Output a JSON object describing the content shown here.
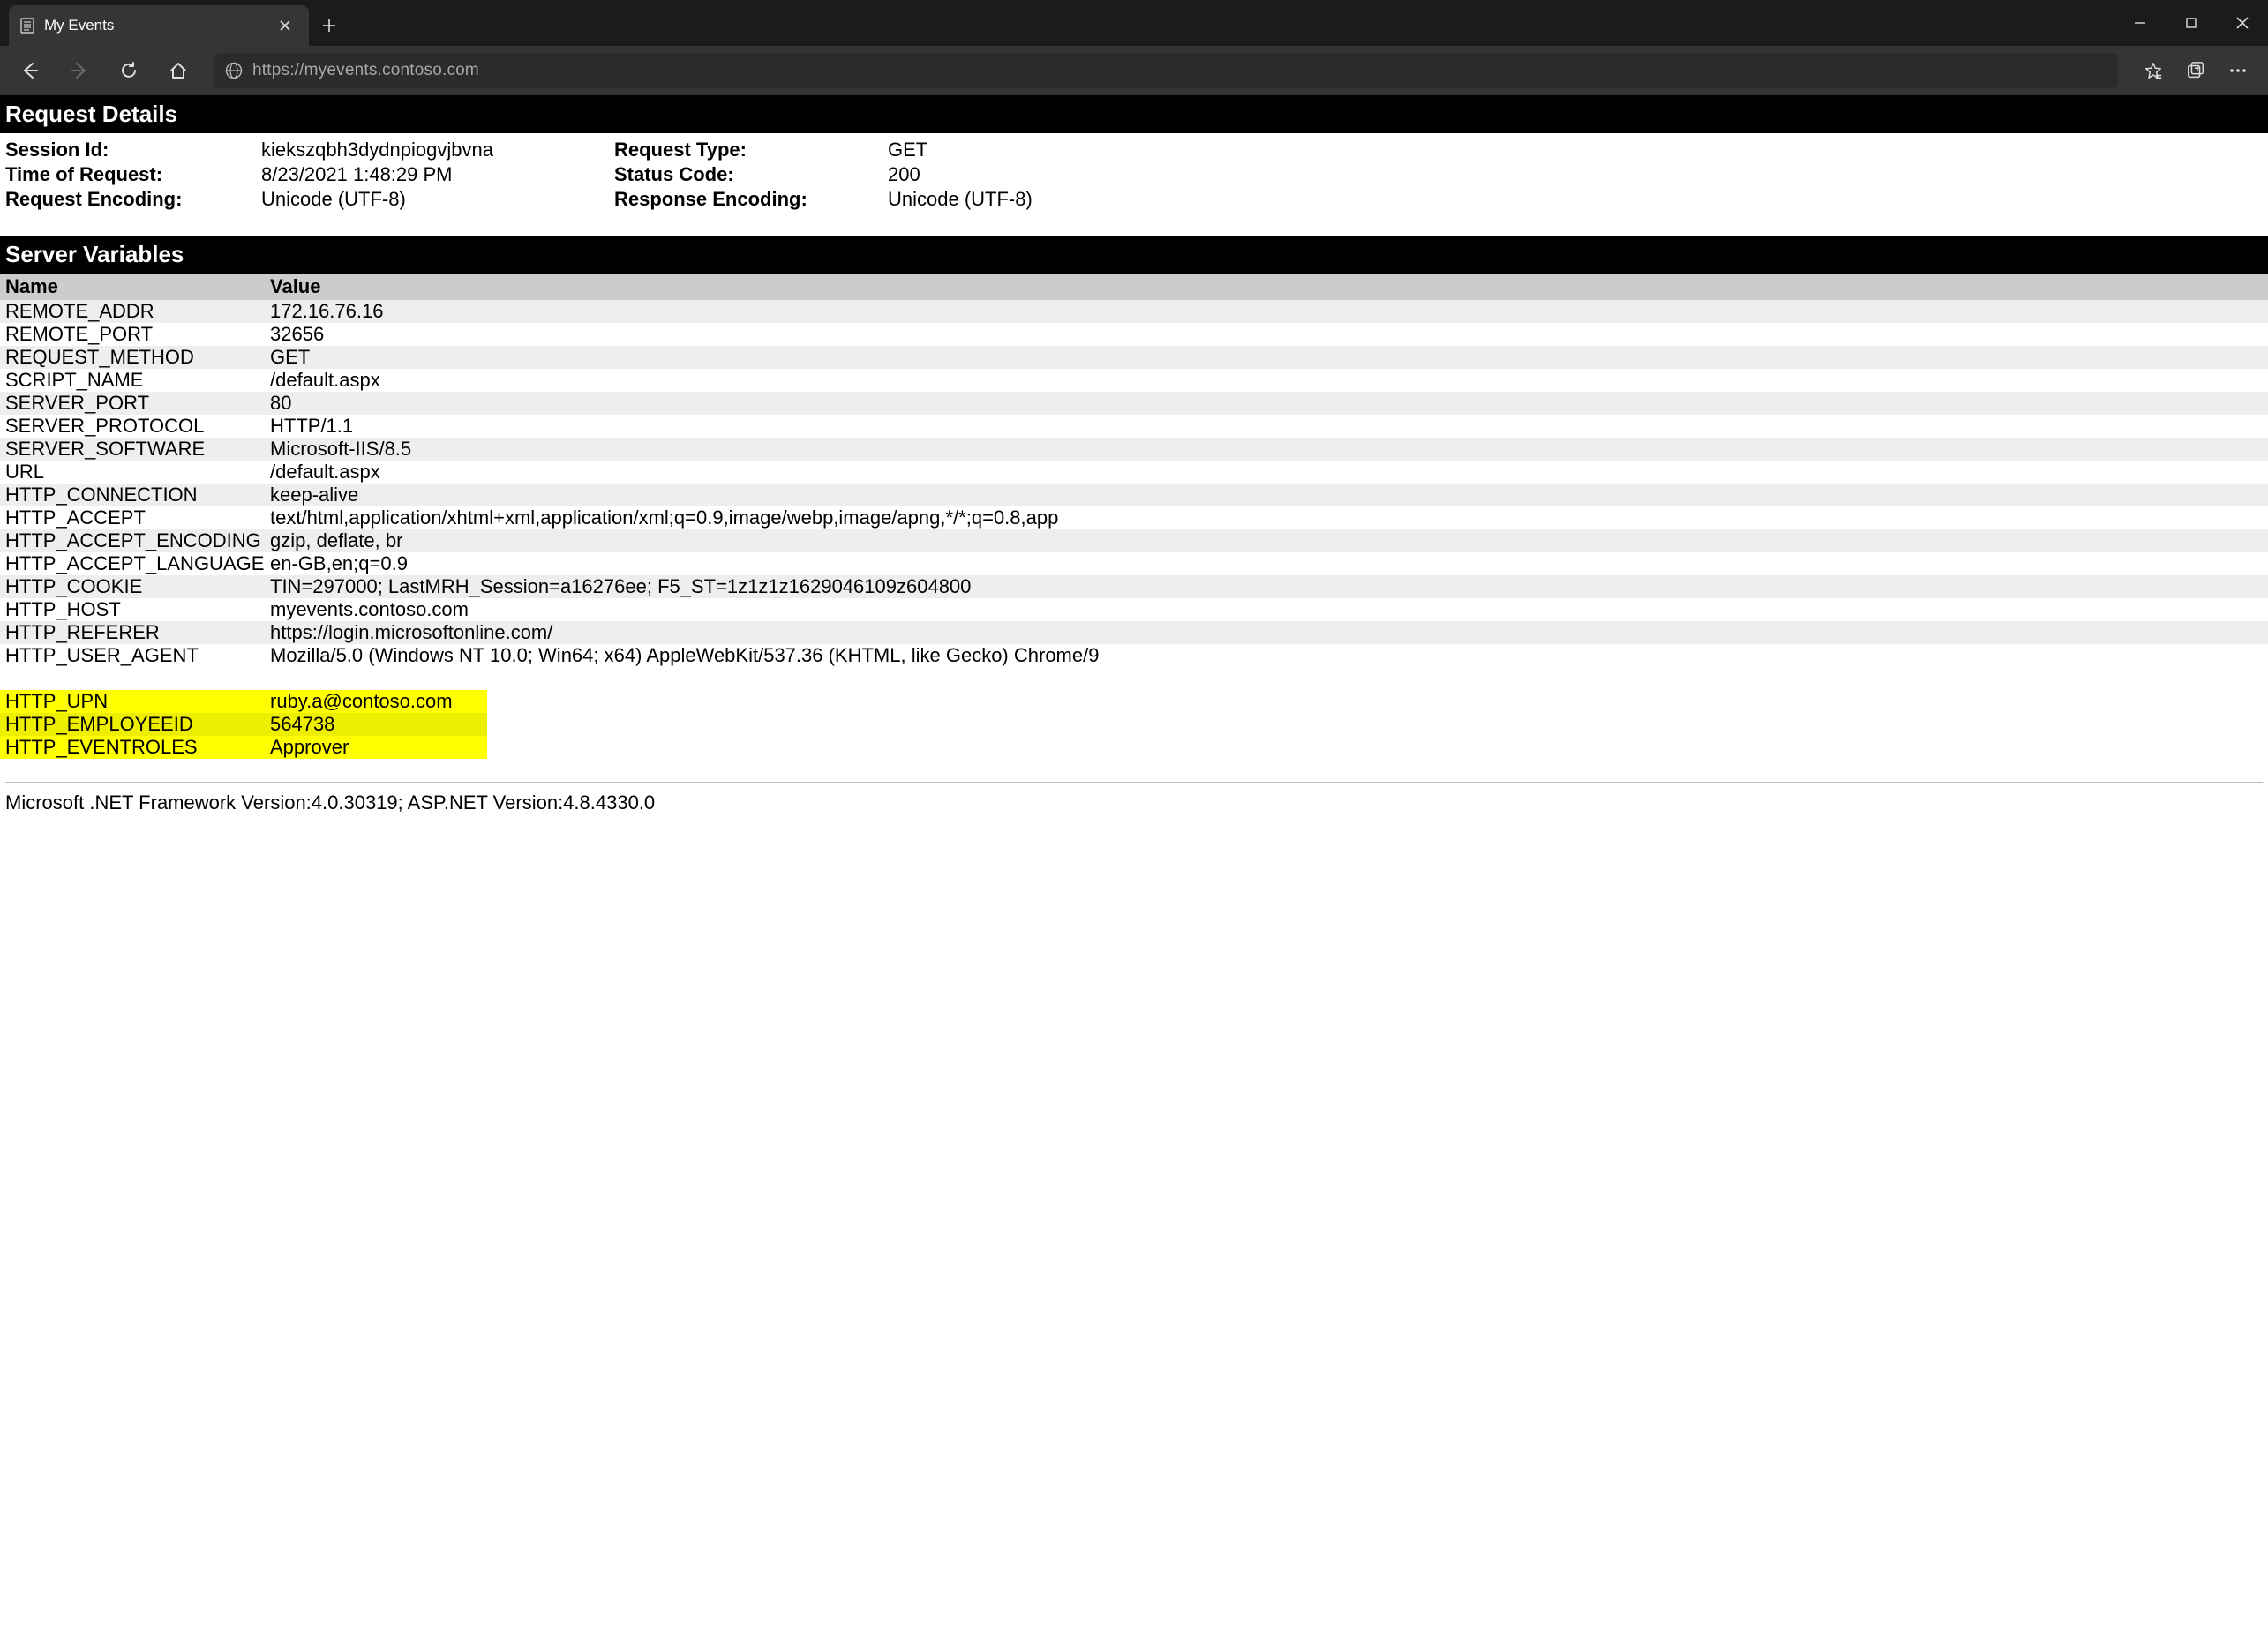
{
  "browser": {
    "tab_title": "My Events",
    "url": "https://myevents.contoso.com"
  },
  "request_details": {
    "title": "Request Details",
    "left": [
      {
        "label": "Session Id:",
        "value": "kiekszqbh3dydnpiogvjbvna"
      },
      {
        "label": "Time of Request:",
        "value": "8/23/2021 1:48:29 PM"
      },
      {
        "label": "Request Encoding:",
        "value": "Unicode (UTF-8)"
      }
    ],
    "right": [
      {
        "label": "Request Type:",
        "value": "GET"
      },
      {
        "label": "Status Code:",
        "value": "200"
      },
      {
        "label": "Response Encoding:",
        "value": "Unicode (UTF-8)"
      }
    ]
  },
  "server_vars": {
    "title": "Server Variables",
    "columns": {
      "name": "Name",
      "value": "Value"
    },
    "rows": [
      {
        "name": "REMOTE_ADDR",
        "value": "172.16.76.16"
      },
      {
        "name": "REMOTE_PORT",
        "value": "32656"
      },
      {
        "name": "REQUEST_METHOD",
        "value": "GET"
      },
      {
        "name": "SCRIPT_NAME",
        "value": "/default.aspx"
      },
      {
        "name": "SERVER_PORT",
        "value": "80"
      },
      {
        "name": "SERVER_PROTOCOL",
        "value": "HTTP/1.1"
      },
      {
        "name": "SERVER_SOFTWARE",
        "value": "Microsoft-IIS/8.5"
      },
      {
        "name": "URL",
        "value": "/default.aspx"
      },
      {
        "name": "HTTP_CONNECTION",
        "value": "keep-alive"
      },
      {
        "name": "HTTP_ACCEPT",
        "value": "text/html,application/xhtml+xml,application/xml;q=0.9,image/webp,image/apng,*/*;q=0.8,app"
      },
      {
        "name": "HTTP_ACCEPT_ENCODING",
        "value": "gzip, deflate, br"
      },
      {
        "name": "HTTP_ACCEPT_LANGUAGE",
        "value": "en-GB,en;q=0.9"
      },
      {
        "name": "HTTP_COOKIE",
        "value": "TIN=297000; LastMRH_Session=a16276ee; F5_ST=1z1z1z1629046109z604800"
      },
      {
        "name": "HTTP_HOST",
        "value": "myevents.contoso.com"
      },
      {
        "name": "HTTP_REFERER",
        "value": "https://login.microsoftonline.com/"
      },
      {
        "name": "HTTP_USER_AGENT",
        "value": "Mozilla/5.0 (Windows NT 10.0; Win64; x64) AppleWebKit/537.36 (KHTML, like Gecko) Chrome/9"
      }
    ],
    "highlighted": [
      {
        "name": "HTTP_UPN",
        "value": "ruby.a@contoso.com"
      },
      {
        "name": "HTTP_EMPLOYEEID",
        "value": "564738"
      },
      {
        "name": "HTTP_EVENTROLES",
        "value": "Approver"
      }
    ]
  },
  "footer": "Microsoft .NET Framework Version:4.0.30319; ASP.NET Version:4.8.4330.0"
}
